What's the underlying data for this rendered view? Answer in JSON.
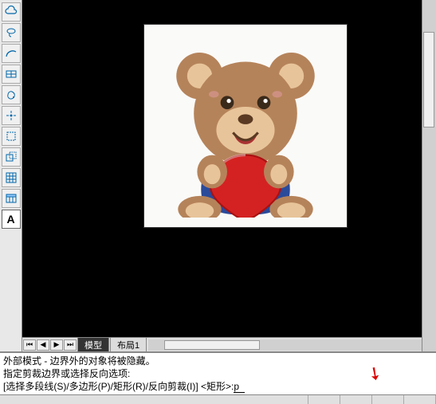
{
  "toolbar": {
    "tools": [
      {
        "name": "cloud-tool",
        "icon": "cloud"
      },
      {
        "name": "lasso-tool",
        "icon": "lasso"
      },
      {
        "name": "arc-tool",
        "icon": "arc"
      },
      {
        "name": "table-tool",
        "icon": "table-grid"
      },
      {
        "name": "shape-tool",
        "icon": "blob"
      },
      {
        "name": "point-tool",
        "icon": "point"
      },
      {
        "name": "crop-tool",
        "icon": "crop"
      },
      {
        "name": "trim-tool",
        "icon": "trim"
      },
      {
        "name": "grid-tool",
        "icon": "grid"
      },
      {
        "name": "spreadsheet-tool",
        "icon": "spreadsheet"
      }
    ],
    "text_tool_label": "A"
  },
  "image": {
    "description": "cartoon teddy bear holding red heart",
    "bg": "#fafaf8"
  },
  "tabs": {
    "nav_first": "⏮",
    "nav_prev": "◀",
    "nav_next": "▶",
    "nav_last": "⏭",
    "model": "模型",
    "layout1": "布局1",
    "active": "model"
  },
  "command": {
    "line1": "外部模式 - 边界外的对象将被隐藏。",
    "line2": "指定剪裁边界或选择反向选项:",
    "line3_prefix": "[选择多段线(S)/多边形(P)/矩形(R)/反向剪裁(I)] <矩形>: ",
    "input_value": "p"
  },
  "colors": {
    "canvas_bg": "#000000",
    "panel_bg": "#e0e0e0",
    "annotation": "#dd0000"
  }
}
